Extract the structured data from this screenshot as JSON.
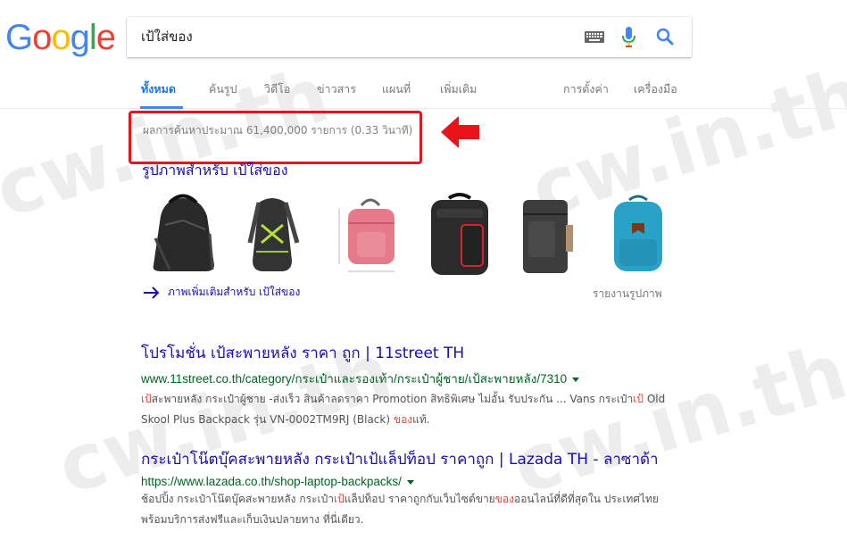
{
  "logo": {
    "letters": [
      "G",
      "o",
      "o",
      "g",
      "l",
      "e"
    ],
    "colors": [
      "#4285f4",
      "#ea4335",
      "#fbbc05",
      "#4285f4",
      "#34a853",
      "#ea4335"
    ]
  },
  "search": {
    "query": "เป้ใส่ของ"
  },
  "tabs": {
    "all": "ทั้งหมด",
    "images": "ค้นรูป",
    "videos": "วิดีโอ",
    "news": "ข่าวสาร",
    "maps": "แผนที่",
    "more": "เพิ่มเติม",
    "settings": "การตั้งค่า",
    "tools": "เครื่องมือ"
  },
  "result_stats": "ผลการค้นหาประมาณ 61,400,000 รายการ (0.33 วินาที)",
  "images_section": {
    "heading": "รูปภาพสำหรับ เป้ใส่ของ",
    "more_link": "ภาพเพิ่มเติมสำหรับ เป้ใส่ของ",
    "report": "รายงานรูปภาพ"
  },
  "results": [
    {
      "title": "โปรโมชั่น เป้สะพายหลัง ราคา ถูก | 11street TH",
      "url": "www.11street.co.th/category/กระเป๋าและรองเท้า/กระเป๋าผู้ชาย/เป้สะพายหลัง/7310",
      "snippet_line1_em": "เป้",
      "snippet_line1": "สะพายหลัง กระเป๋าผู้ชาย -ส่งเร็ว สินค้าลดราคา Promotion สิทธิพิเศษ ไม่อั้น รับประกัน ... Vans กระเป๋า",
      "snippet_line1_em2": "เป้",
      "snippet_line1_end": " Old",
      "snippet_line2": "Skool Plus Backpack รุ่น VN-0002TM9RJ (Black) ",
      "snippet_line2_em": "ของ",
      "snippet_line2_end": "แท้."
    },
    {
      "title": "กระเป๋าโน๊ตบุ๊คสะพายหลัง กระเป๋าเป้แล็ปท็อป ราคาถูก | Lazada TH - ลาซาด้า",
      "url": "https://www.lazada.co.th/shop-laptop-backpacks/",
      "snippet_line1": "ช้อปปิ้ง กระเป๋าโน๊ตบุ๊คสะพายหลัง กระเป๋า",
      "snippet_line1_em": "เป้",
      "snippet_line1_mid": "แล็ปท็อป ราคาถูกกับเว็บไซต์ขาย",
      "snippet_line1_em2": "ของ",
      "snippet_line1_end": "ออนไลน์ที่ดีที่สุดใน ประเทศไทย",
      "snippet_line2": "พร้อมบริการส่งฟรีและเก็บเงินปลายทาง ที่นี่เดียว."
    }
  ],
  "watermark": "cw.in.th"
}
